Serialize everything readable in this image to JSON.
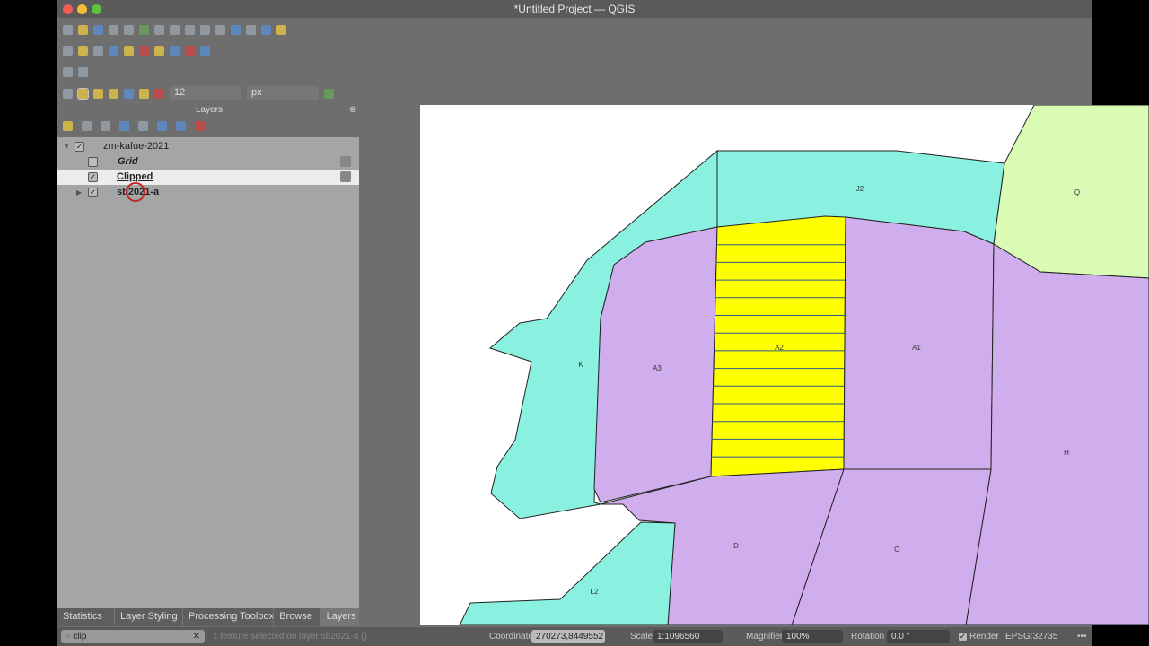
{
  "window": {
    "title": "*Untitled Project — QGIS"
  },
  "layers_panel": {
    "title": "Layers",
    "close": "⊗",
    "items": [
      {
        "name": "zm-kafue-2021",
        "checked": true,
        "check": "✓"
      },
      {
        "name": "Grid",
        "checked": false,
        "check": ""
      },
      {
        "name": "Clipped",
        "checked": true,
        "check": "✓"
      },
      {
        "name": "sb2021-a",
        "checked": true,
        "check": "✓"
      }
    ]
  },
  "toolbar": {
    "font_size": "12",
    "unit": "px"
  },
  "bottom_tabs": [
    "Statistics",
    "Layer Styling",
    "Processing Toolbox",
    "Browse",
    "Layers"
  ],
  "search": {
    "value": "clip",
    "clear": "✕"
  },
  "status": {
    "message": "1 feature selected on layer sb2021-a ().",
    "coordinate_label": "Coordinate",
    "coordinate": "270273,8449552",
    "scale_label": "Scale",
    "scale": "1:1096560",
    "magnifier_label": "Magnifier",
    "magnifier": "100%",
    "rotation_label": "Rotation",
    "rotation": "0.0 °",
    "render_label": "Render",
    "render_check": "✓",
    "crs": "EPSG:32735",
    "more": "•••"
  },
  "map": {
    "labels": {
      "J2": "J2",
      "Q": "Q",
      "K": "K",
      "A3": "A3",
      "A2": "A2",
      "A1": "A1",
      "H": "H",
      "D": "D",
      "C": "C",
      "L2": "L2"
    },
    "colors": {
      "cyan": "#8af0e0",
      "purple": "#d0aeee",
      "yellow": "#ffff00",
      "green": "#d9fbb4"
    }
  }
}
